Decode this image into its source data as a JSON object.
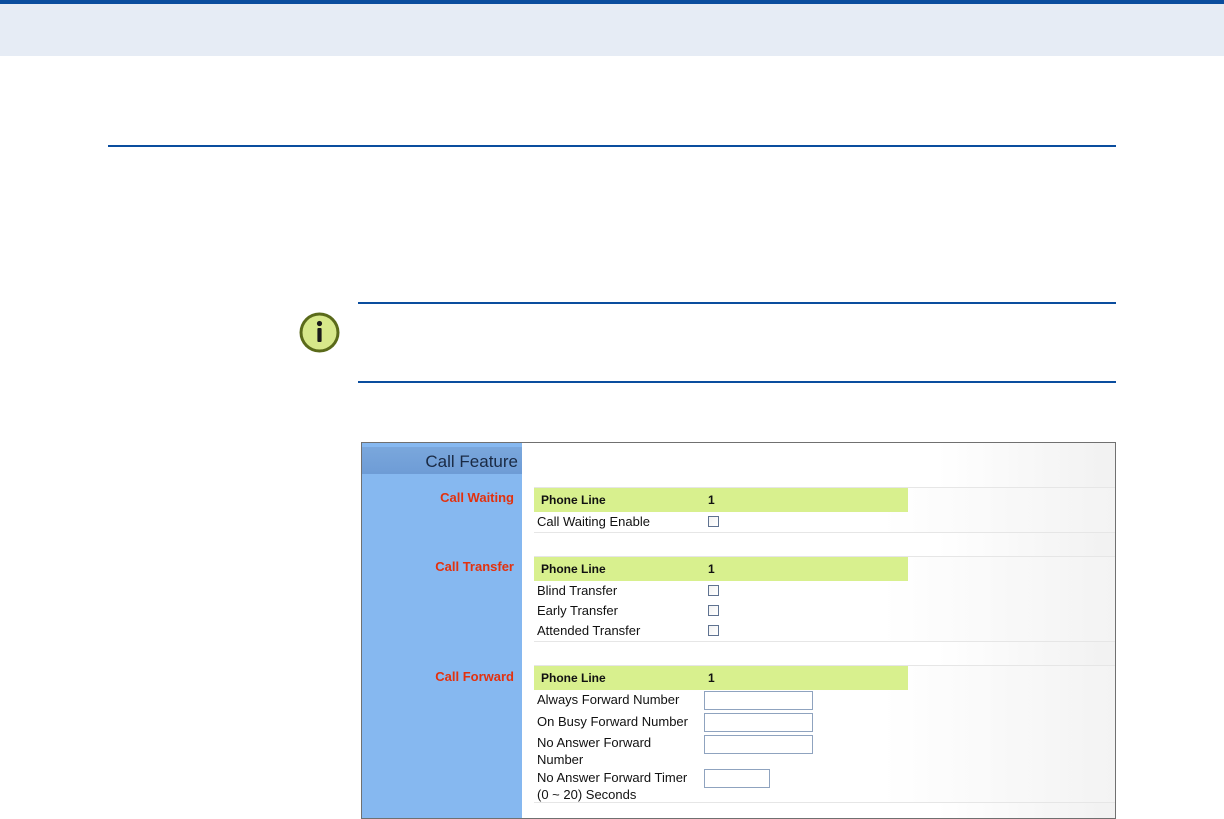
{
  "call_feature": {
    "title": "Call Feature",
    "sections": {
      "call_waiting": {
        "label": "Call Waiting",
        "phone_line_label": "Phone Line",
        "phone_line_value": "1",
        "enable_label": "Call Waiting Enable",
        "enable_checked": false
      },
      "call_transfer": {
        "label": "Call Transfer",
        "phone_line_label": "Phone Line",
        "phone_line_value": "1",
        "blind_label": "Blind Transfer",
        "early_label": "Early Transfer",
        "attended_label": "Attended Transfer"
      },
      "call_forward": {
        "label": "Call Forward",
        "phone_line_label": "Phone Line",
        "phone_line_value": "1",
        "always_label": "Always Forward Number",
        "always_value": "",
        "busy_label": "On Busy Forward Number",
        "busy_value": "",
        "no_answer_label_1": "No Answer Forward",
        "no_answer_label_2": "Number",
        "no_answer_value": "",
        "timer_label_1": "No Answer Forward Timer",
        "timer_label_2": "(0 ~ 20) Seconds",
        "timer_value": ""
      }
    }
  },
  "colors": {
    "accent_rule": "#0a4d9e",
    "section_label": "#e3310e",
    "phone_row_bg": "#d8f08e",
    "left_column_bg": "#86b8f0"
  },
  "icons": {
    "note": "info-icon"
  }
}
